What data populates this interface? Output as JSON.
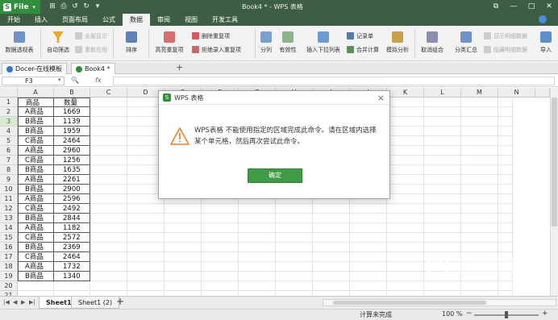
{
  "app": {
    "file_label": "File",
    "window_title": "Book4 * - WPS 表格",
    "quick_access": [
      "⊞",
      "⎙",
      "↺",
      "↻",
      "▾"
    ]
  },
  "menu": [
    "开始",
    "插入",
    "页面布局",
    "公式",
    "数据",
    "审阅",
    "视图",
    "开发工具"
  ],
  "menu_active_index": 4,
  "ribbon": {
    "pivot": "数据透视表",
    "autofilter": "自动筛选",
    "show_all": "全部显示",
    "reapply": "重新应用",
    "sort": "排序",
    "highlight_dup": "高亮重复项",
    "remove_dup": "删除重复项",
    "reject_dup": "拒绝录入重复项",
    "split": "分列",
    "validity": "有效性",
    "insert_dropdown": "插入下拉列表",
    "merge_calc": "合并计算",
    "record_form": "记录单",
    "what_if": "模拟分析",
    "ungroup": "取消组合",
    "subtotal": "分类汇总",
    "show_detail": "显示明细数据",
    "hide_detail": "隐藏明细数据",
    "import": "导入"
  },
  "doc_tabs": [
    "Docer-在线模板",
    "Book4 *"
  ],
  "formula_bar": {
    "namebox": "F3",
    "fx_label": "fx"
  },
  "columns": [
    "A",
    "B",
    "C",
    "D",
    "E",
    "F",
    "G",
    "H",
    "I",
    "J",
    "K",
    "L",
    "M",
    "N"
  ],
  "rows": [
    {
      "n": "1",
      "a": "商品",
      "b": "数量"
    },
    {
      "n": "2",
      "a": "A商品",
      "b": "1669"
    },
    {
      "n": "3",
      "a": "B商品",
      "b": "1139"
    },
    {
      "n": "4",
      "a": "B商品",
      "b": "1959"
    },
    {
      "n": "5",
      "a": "C商品",
      "b": "2464"
    },
    {
      "n": "6",
      "a": "A商品",
      "b": "2960"
    },
    {
      "n": "7",
      "a": "C商品",
      "b": "1256"
    },
    {
      "n": "8",
      "a": "B商品",
      "b": "1635"
    },
    {
      "n": "9",
      "a": "A商品",
      "b": "2261"
    },
    {
      "n": "10",
      "a": "B商品",
      "b": "2900"
    },
    {
      "n": "11",
      "a": "A商品",
      "b": "2596"
    },
    {
      "n": "12",
      "a": "C商品",
      "b": "2492"
    },
    {
      "n": "13",
      "a": "B商品",
      "b": "2844"
    },
    {
      "n": "14",
      "a": "A商品",
      "b": "1182"
    },
    {
      "n": "15",
      "a": "C商品",
      "b": "2572"
    },
    {
      "n": "16",
      "a": "B商品",
      "b": "2369"
    },
    {
      "n": "17",
      "a": "C商品",
      "b": "2464"
    },
    {
      "n": "18",
      "a": "A商品",
      "b": "1732"
    },
    {
      "n": "19",
      "a": "B商品",
      "b": "1340"
    },
    {
      "n": "20",
      "a": "",
      "b": ""
    },
    {
      "n": "21",
      "a": "",
      "b": ""
    }
  ],
  "selected_row": "3",
  "sheets": [
    "Sheet1",
    "Sheet1 (2)"
  ],
  "status": {
    "calc": "计算未完成",
    "zoom": "100 %"
  },
  "dialog": {
    "title": "WPS 表格",
    "message": "WPS表格 不能使用指定的区域完成此命令。请在区域内选择某个单元格，然后再次尝试此命令。",
    "ok": "确定"
  },
  "colors": {
    "accent": "#3f9b46",
    "titlebar": "#3d5e44",
    "warning": "#e8812b"
  }
}
